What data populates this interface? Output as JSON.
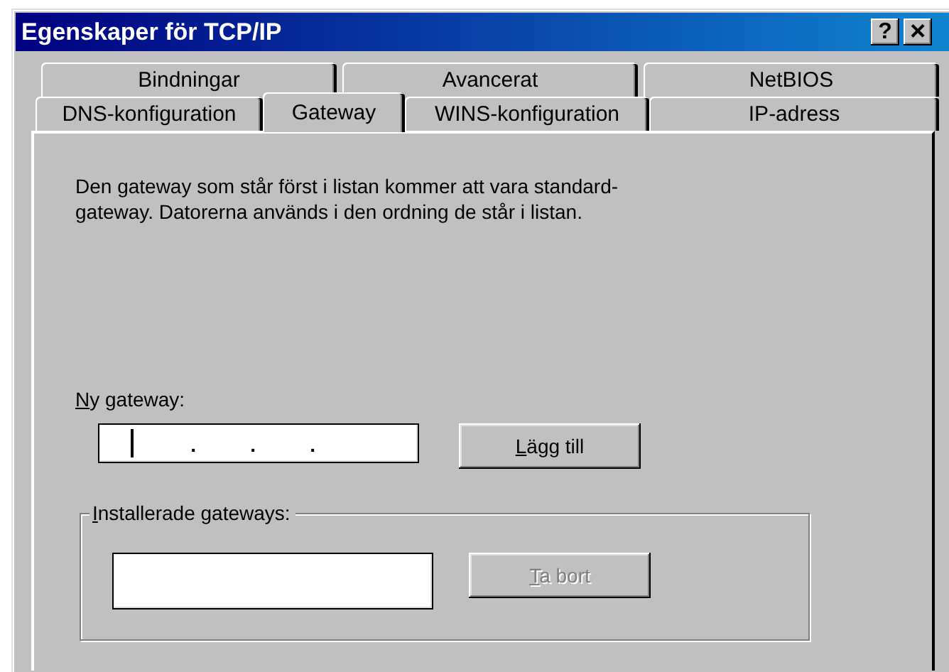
{
  "window": {
    "title": "Egenskaper för TCP/IP",
    "help_button": "?",
    "close_button": "×"
  },
  "tab_rows": [
    [
      {
        "label": "Bindningar",
        "selected": false
      },
      {
        "label": "Avancerat",
        "selected": false
      },
      {
        "label": "NetBIOS",
        "selected": false
      }
    ],
    [
      {
        "label": "DNS-konfiguration",
        "selected": false
      },
      {
        "label": "Gateway",
        "selected": true
      },
      {
        "label": "WINS-konfiguration",
        "selected": false
      },
      {
        "label": "IP-adress",
        "selected": false
      }
    ]
  ],
  "description": "Den gateway som står först i listan kommer att vara standard-gateway. Datorerna används i den ordning de står i listan.",
  "new_gateway": {
    "label": "Ny gateway:",
    "mnemonic_first": true,
    "separators": [
      ".",
      ".",
      "."
    ],
    "focused": true
  },
  "add_button": {
    "label": "Lägg till",
    "mnemonic_first": true,
    "disabled": false
  },
  "installed_group": {
    "label": "Installerade gateways:",
    "mnemonic_first": true
  },
  "remove_button": {
    "label": "Ta bort",
    "mnemonic_first": true,
    "disabled": true
  }
}
